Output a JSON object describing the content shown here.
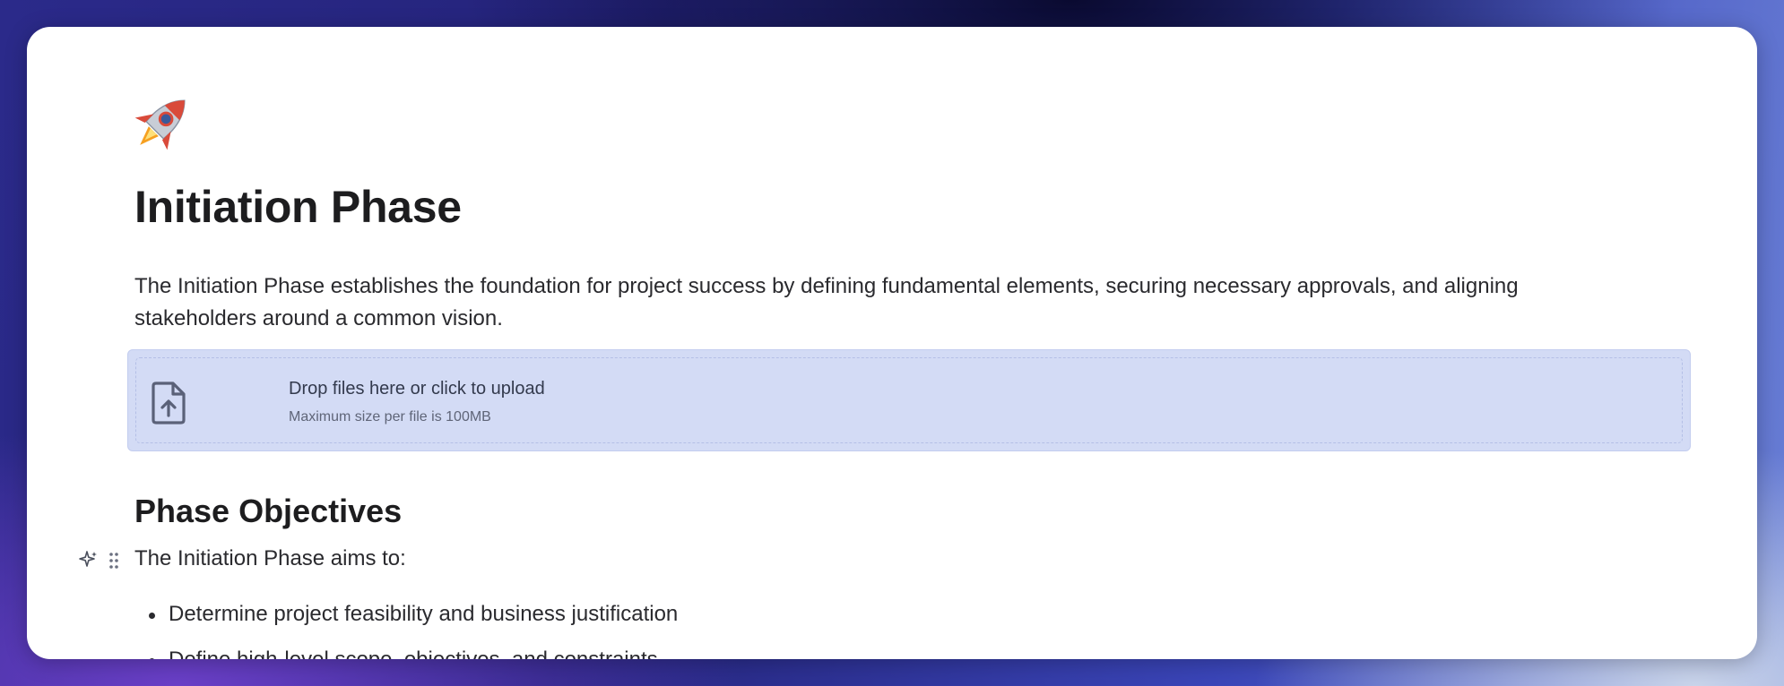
{
  "page": {
    "icon": "rocket-emoji",
    "title": "Initiation Phase",
    "intro": "The Initiation Phase establishes the foundation for project success by defining fundamental elements, securing necessary approvals, and aligning stakeholders around a common vision."
  },
  "upload": {
    "icon": "file-upload-icon",
    "label": "Drop files here or click to upload",
    "sublabel": "Maximum size per file is 100MB"
  },
  "section": {
    "heading": "Phase Objectives",
    "paragraph": "The Initiation Phase aims to:",
    "items": [
      "Determine project feasibility and business justification",
      "Define high-level scope, objectives, and constraints"
    ]
  },
  "block_tools": {
    "ai_icon": "sparkle-icon",
    "drag_icon": "drag-handle-icon"
  },
  "colors": {
    "upload_background": "#d3dbf5",
    "text": "#2a2a2e",
    "heading": "#1d1d1f"
  }
}
